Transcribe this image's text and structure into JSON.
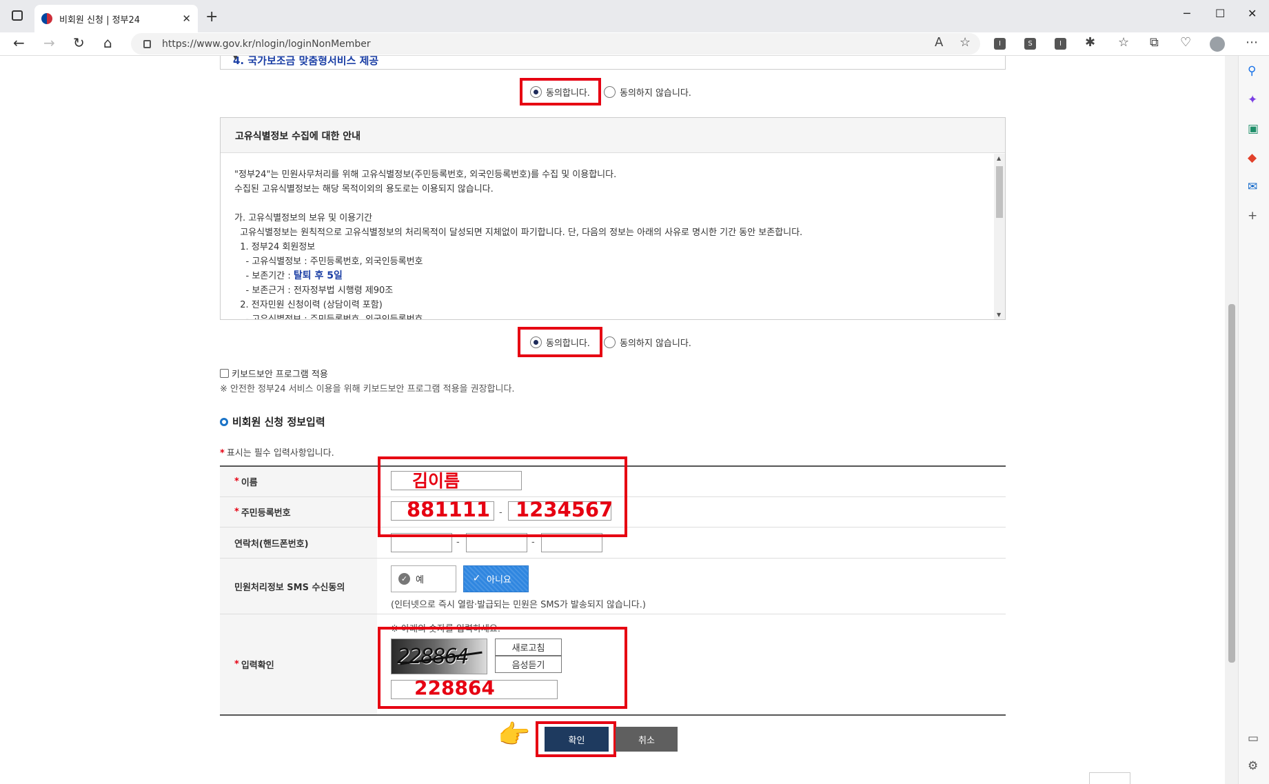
{
  "browser": {
    "tab_title": "비회원 신청 | 정부24",
    "tab_close": "✕",
    "new_tab": "+",
    "url": "https://www.gov.kr/nlogin/loginNonMember",
    "min": "─",
    "max": "☐",
    "close": "✕",
    "toolbar_icons": [
      "read-aloud-icon",
      "favorite-add-icon",
      "extension-icon",
      "extension-s-icon",
      "extension-icon",
      "extensions-icon",
      "favorites-icon",
      "collections-icon",
      "browser-essentials-icon",
      "profile-icon",
      "more-icon"
    ]
  },
  "sidebar_icons": [
    "search-icon",
    "copilot-icon",
    "tools-icon",
    "office-icon",
    "outlook-icon",
    "add-icon",
    "split-icon",
    "settings-icon"
  ],
  "terms_top": {
    "title": "4. 국가보조금 맞춤형서비스 제공"
  },
  "agree1": {
    "agree_label": "동의합니다.",
    "disagree_label": "동의하지 않습니다.",
    "selected": "agree"
  },
  "unique_info": {
    "heading": "고유식별정보 수집에 대한 안내",
    "lines": [
      "\"정부24\"는 민원사무처리를 위해 고유식별정보(주민등록번호, 외국인등록번호)를 수집 및 이용합니다.",
      "수집된 고유식별정보는 해당 목적이외의 용도로는 이용되지 않습니다.",
      "",
      "가. 고유식별정보의 보유 및 이용기간",
      "  고유식별정보는 원칙적으로 고유식별정보의 처리목적이 달성되면 지체없이 파기합니다. 단, 다음의 정보는 아래의 사유로 명시한 기간 동안 보존합니다.",
      "  1. 정부24 회원정보",
      "    - 고유식별정보 : 주민등록번호, 외국인등록번호",
      "    - 보존기간 : ",
      "    - 보존근거 : 전자정부법 시행령 제90조",
      "  2. 전자민원 신청이력 (상담이력 포함)",
      "    - 고유식별정보 : 주민등록번호, 외국인등록번호"
    ],
    "retention_highlight": "탈퇴 후 5일"
  },
  "agree2": {
    "agree_label": "동의합니다.",
    "disagree_label": "동의하지 않습니다.",
    "selected": "agree"
  },
  "keyboard": {
    "checkbox_label": "키보드보안 프로그램 적용",
    "note": "※ 안전한 정부24 서비스 이용을 위해 키보드보안 프로그램 적용을 권장합니다."
  },
  "section_title": "비회원 신청 정보입력",
  "required_note": "표시는 필수 입력사항입니다.",
  "required_star": "*",
  "form": {
    "name_label": "이름",
    "name_value": "김이름",
    "rrn_label": "주민등록번호",
    "rrn_front": "881111",
    "rrn_back": "1234567",
    "phone_label": "연락처(핸드폰번호)",
    "sms_label": "민원처리정보 SMS 수신동의",
    "sms_yes": "예",
    "sms_no": "아니요",
    "sms_selected": "no",
    "sms_note": "(인터넷으로 즉시 열람·발급되는 민원은 SMS가 발송되지 않습니다.)",
    "captcha_label": "입력확인",
    "captcha_note": "※ 아래의 숫자를 입력하세요.",
    "captcha_image_text": "228864",
    "refresh_label": "새로고침",
    "audio_label": "음성듣기",
    "captcha_value": "228864",
    "dash": "-"
  },
  "buttons": {
    "confirm": "확인",
    "cancel": "취소"
  },
  "colors": {
    "highlight_red": "#e60012",
    "confirm_bg": "#1e3a5f",
    "sms_selected_bg": "#2f86e0",
    "link_blue": "#1b3fa5"
  }
}
